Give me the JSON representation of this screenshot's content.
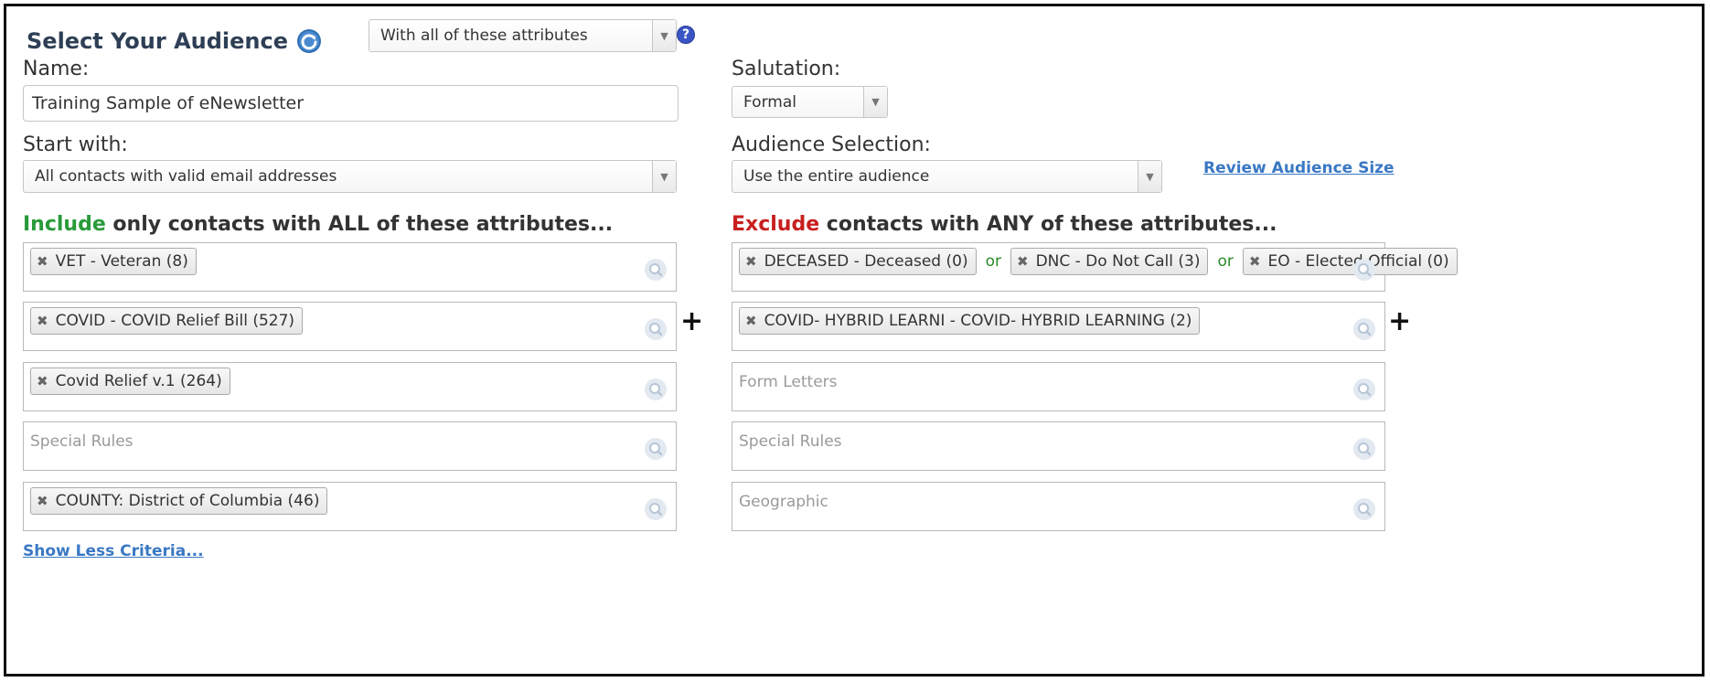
{
  "header": {
    "title": "Select Your Audience",
    "match_select": "With all of these attributes"
  },
  "form": {
    "name_label": "Name:",
    "name_value": "Training Sample of eNewsletter",
    "salutation_label": "Salutation:",
    "salutation_value": "Formal",
    "start_label": "Start with:",
    "start_value": "All contacts with valid email addresses",
    "audience_label": "Audience Selection:",
    "audience_value": "Use the entire audience",
    "review_link": "Review Audience Size"
  },
  "include": {
    "word": "Include",
    "rest": " only contacts with ALL of these attributes...",
    "rows": [
      {
        "tags": [
          "VET - Veteran (8)"
        ],
        "placeholder": ""
      },
      {
        "tags": [
          "COVID - COVID Relief Bill (527)"
        ],
        "placeholder": ""
      },
      {
        "tags": [
          "Covid Relief v.1 (264)"
        ],
        "placeholder": ""
      },
      {
        "tags": [],
        "placeholder": "Special Rules"
      },
      {
        "tags": [
          "COUNTY: District of Columbia (46)"
        ],
        "placeholder": ""
      }
    ]
  },
  "exclude": {
    "word": "Exclude",
    "rest": " contacts with ANY of these attributes...",
    "or_word": "or",
    "rows": [
      {
        "tags": [
          "DECEASED - Deceased (0)",
          "DNC - Do Not Call (3)",
          "EO - Elected Official (0)"
        ],
        "placeholder": ""
      },
      {
        "tags": [
          "COVID- HYBRID LEARNI - COVID- HYBRID LEARNING (2)"
        ],
        "placeholder": ""
      },
      {
        "tags": [],
        "placeholder": "Form Letters"
      },
      {
        "tags": [],
        "placeholder": "Special Rules"
      },
      {
        "tags": [],
        "placeholder": "Geographic"
      }
    ]
  },
  "footer": {
    "show_less": "Show Less Criteria..."
  },
  "symbols": {
    "remove": "✖",
    "plus": "+",
    "help": "?"
  },
  "colors": {
    "title": "#2e3f55",
    "include": "#2a9a3a",
    "exclude": "#c81f1f",
    "link": "#3a78c4",
    "help": "#3a55c4"
  }
}
